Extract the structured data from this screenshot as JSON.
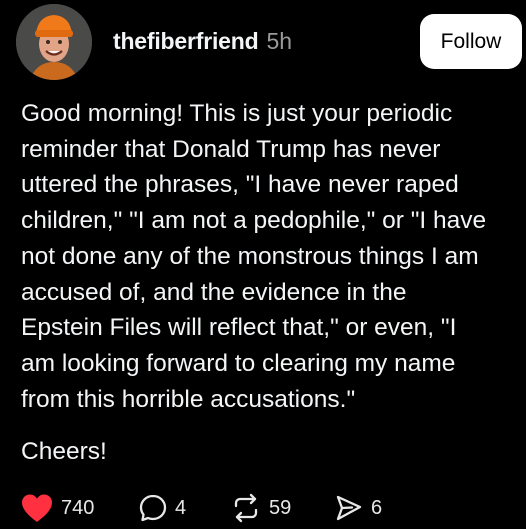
{
  "post": {
    "author": {
      "username": "thefiberfriend",
      "timestamp": "5h",
      "follow_label": "Follow"
    },
    "body_lines": [
      "Good morning! This is just your periodic",
      "reminder that Donald Trump has never",
      "uttered the phrases, \"I have never raped",
      "children,\" \"I am not a pedophile,\" or \"I have",
      "not done any of the monstrous things I am",
      "accused of, and the evidence in the",
      "Epstein Files will reflect that,\" or even, \"I",
      "am looking forward to clearing my name",
      "from this horrible accusations.\""
    ],
    "closing": "Cheers!",
    "actions": {
      "likes": "740",
      "comments": "4",
      "reposts": "59",
      "shares": "6"
    }
  },
  "icons": {
    "like": "heart-icon",
    "comment": "comment-bubble-icon",
    "repost": "repost-icon",
    "share": "share-send-icon"
  },
  "colors": {
    "background": "#000000",
    "text": "#f3f5f7",
    "muted": "#9a9a9a",
    "like_active": "#ff3040",
    "follow_button_bg": "#ffffff",
    "follow_button_text": "#000000"
  }
}
